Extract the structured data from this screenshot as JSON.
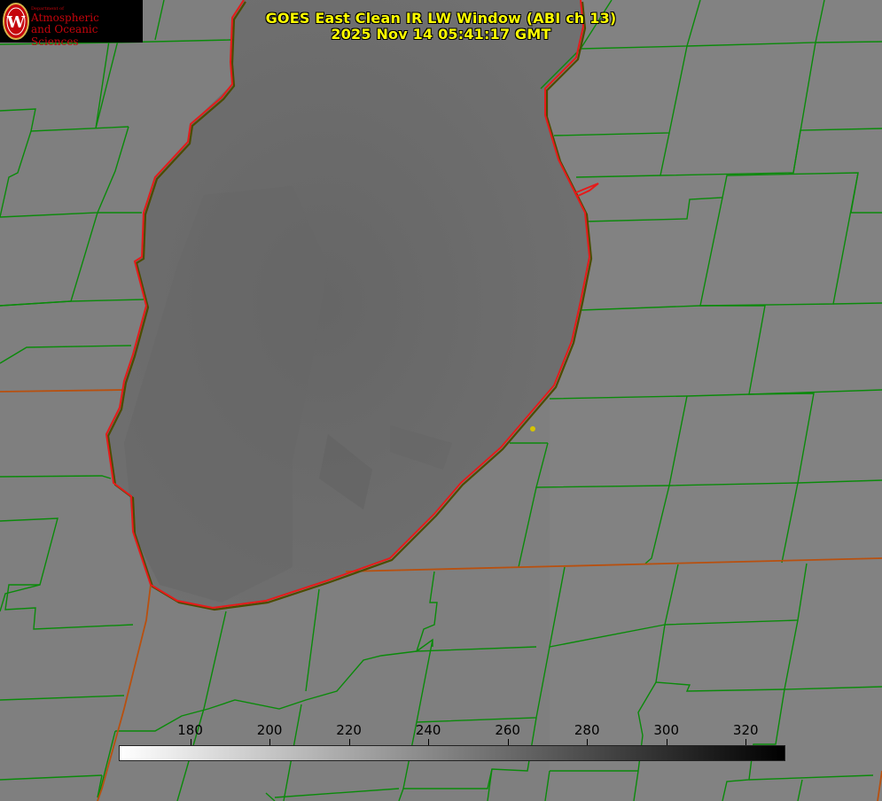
{
  "title_line1": "GOES East Clean IR LW Window (ABI ch 13)",
  "title_line2": "2025 Nov 14 05:41:17 GMT",
  "logo": {
    "small_text": "Department of",
    "line1": "Atmospheric",
    "line2": "and Oceanic Sciences",
    "seal_letter": "W"
  },
  "colorbar": {
    "min": 162,
    "max": 330,
    "ticks": [
      "180",
      "200",
      "220",
      "240",
      "260",
      "280",
      "300",
      "320"
    ],
    "tick_values": [
      180,
      200,
      220,
      240,
      260,
      280,
      300,
      320
    ]
  },
  "colors": {
    "lake_outline": "#e61a1a",
    "county_lines": "#0a8a0a",
    "state_lines": "#b8500f",
    "title_text": "#ffff00",
    "marker": "#d6c400"
  }
}
